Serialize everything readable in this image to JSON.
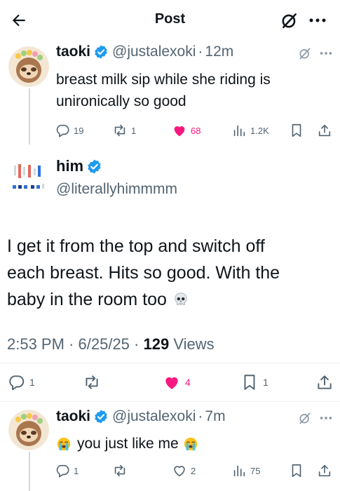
{
  "header": {
    "title": "Post"
  },
  "reply_top": {
    "display_name": "taoki",
    "handle": "@justalexoki",
    "separator": "·",
    "time": "12m",
    "text_line1": "breast milk sip while she riding is",
    "text_line2": "unironically so good",
    "stats": {
      "replies": "19",
      "reposts": "1",
      "likes": "68",
      "views": "1.2K"
    }
  },
  "main_post": {
    "display_name": "him",
    "handle": "@literallyhimmmm",
    "text_line1": "I get it from the top and switch off",
    "text_line2": "each breast. Hits so good. With the",
    "text_line3": "baby in the room too",
    "time": "2:53 PM",
    "separator": "·",
    "date": "6/25/25",
    "views_count": "129",
    "views_label": "Views",
    "stats": {
      "replies": "1",
      "reposts": "",
      "likes": "4",
      "bookmarks": "1"
    }
  },
  "reply_bottom": {
    "display_name": "taoki",
    "handle": "@justalexoki",
    "separator": "·",
    "time": "7m",
    "text": "you just like me",
    "stats": {
      "replies": "1",
      "reposts": "",
      "likes": "2",
      "views": "75"
    }
  },
  "colors": {
    "like_pink": "#f91880",
    "verified_blue": "#1d9bf0",
    "muted": "#536471"
  }
}
